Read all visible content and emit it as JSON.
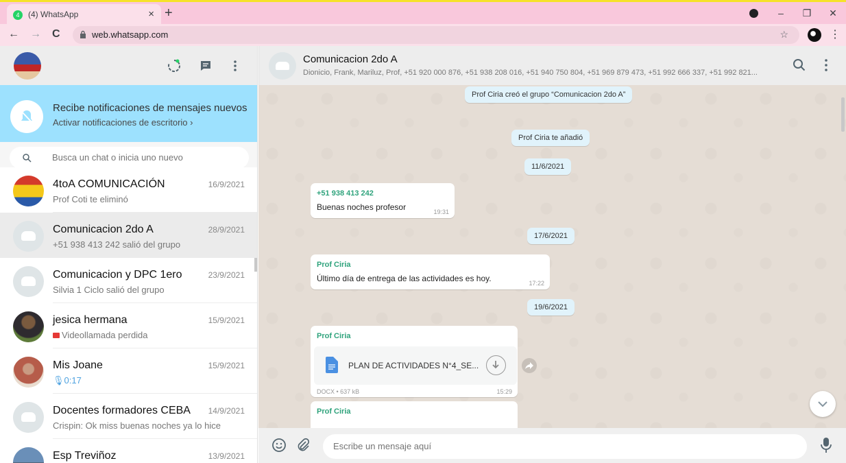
{
  "browser": {
    "tab_title": "(4) WhatsApp",
    "tab_favicon_label": "4",
    "url": "web.whatsapp.com"
  },
  "notifications": {
    "title": "Recibe notificaciones de mensajes nuevos",
    "subtitle": "Activar notificaciones de escritorio ›"
  },
  "search": {
    "placeholder": "Busca un chat o inicia uno nuevo"
  },
  "chats": [
    {
      "name": "4toA COMUNICACIÓN",
      "date": "16/9/2021",
      "last": "Prof Coti te eliminó"
    },
    {
      "name": "Comunicacion 2do A",
      "date": "28/9/2021",
      "last": "+51 938 413 242 salió del grupo"
    },
    {
      "name": "Comunicacion y DPC 1ero",
      "date": "23/9/2021",
      "last": "Silvia 1 Ciclo salió del grupo"
    },
    {
      "name": "jesica hermana",
      "date": "15/9/2021",
      "last": "Videollamada perdida"
    },
    {
      "name": "Mis Joane",
      "date": "15/9/2021",
      "last": "0:17"
    },
    {
      "name": "Docentes formadores CEBA",
      "date": "14/9/2021",
      "last": "Crispin: Ok miss buenas noches ya lo hice"
    },
    {
      "name": "Esp Treviñoz",
      "date": "13/9/2021",
      "last": ""
    }
  ],
  "conversation": {
    "title": "Comunicacion 2do A",
    "members": "Dionicio, Frank, Mariluz, Prof, +51 920 000 876, +51 938 208 016, +51 940 750 804, +51 969 879 473, +51 992 666 337, +51 992 821..."
  },
  "messages": {
    "sys_created": "Prof Ciria creó el grupo “Comunicacion 2do A”",
    "sys_added": "Prof Ciria te añadió",
    "date1": "11/6/2021",
    "msg1_sender": "+51 938 413 242",
    "msg1_text": "Buenas noches profesor",
    "msg1_time": "19:31",
    "date2": "17/6/2021",
    "msg2_sender": "Prof Ciria",
    "msg2_text": "Último día  de entrega de las actividades  es hoy.",
    "msg2_time": "17:22",
    "date3": "19/6/2021",
    "msg3_sender": "Prof Ciria",
    "msg3_doc_name": "PLAN DE ACTIVIDADES N°4_SE...",
    "msg3_doc_meta": "DOCX • 637 kB",
    "msg3_time": "15:29",
    "msg4_sender": "Prof Ciria"
  },
  "composer": {
    "placeholder": "Escribe un mensaje aquí"
  },
  "colors": {
    "banner": "#9de1fe",
    "sender": "#2fa37c",
    "chat_bg": "#e5ddd5"
  }
}
